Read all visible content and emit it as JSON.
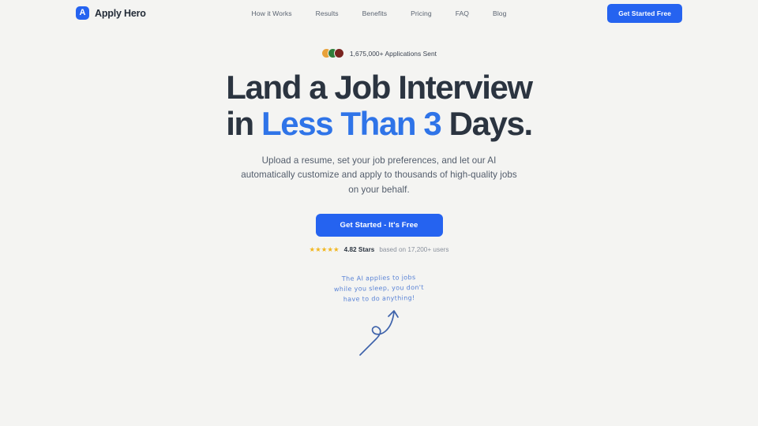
{
  "header": {
    "brand": {
      "mark_letter": "A",
      "name": "Apply Hero"
    },
    "nav": [
      {
        "label": "How it Works"
      },
      {
        "label": "Results"
      },
      {
        "label": "Benefits"
      },
      {
        "label": "Pricing"
      },
      {
        "label": "FAQ"
      },
      {
        "label": "Blog"
      }
    ],
    "cta_label": "Get Started Free"
  },
  "hero": {
    "social_proof": {
      "text": "1,675,000+ Applications Sent",
      "avatar_colors": [
        "#e8a13a",
        "#2f7d3a",
        "#7a2420"
      ]
    },
    "headline": {
      "line1": "Land a Job Interview",
      "line2_prefix": "in ",
      "line2_accent": "Less Than 3",
      "line2_suffix": " Days."
    },
    "subhead": "Upload a resume, set your job preferences, and let our AI automatically customize and apply to thousands of high-quality jobs on your behalf.",
    "cta_label": "Get Started - It's Free",
    "rating": {
      "stars_glyph": "★★★★★",
      "score": "4.82 Stars",
      "meta": "based on 17,200+ users"
    },
    "annotation": {
      "text": "The AI applies to jobs\nwhile you sleep, you don't\nhave to do anything!",
      "arrow_icon": "curly-up-arrow"
    }
  },
  "colors": {
    "page_background": "#f4f4f2",
    "brand_blue": "#2563f0",
    "accent_blue": "#2f74e8",
    "headline_navy": "#2b3440",
    "star_gold": "#f2b720",
    "annotation_blue": "#5b84d6"
  }
}
